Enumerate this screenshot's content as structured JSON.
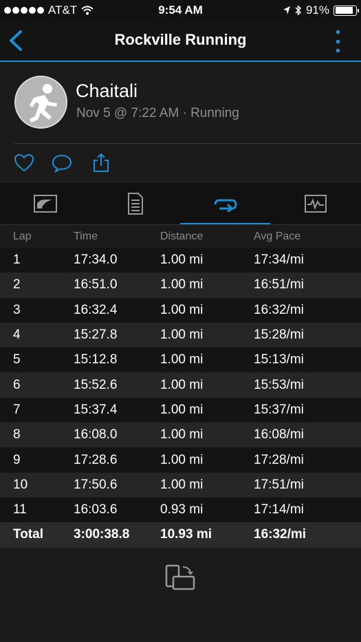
{
  "status_bar": {
    "carrier": "AT&T",
    "time": "9:54 AM",
    "battery": "91%",
    "battery_level": 0.91
  },
  "header": {
    "title": "Rockville Running"
  },
  "profile": {
    "name": "Chaitali",
    "meta": "Nov 5 @ 7:22 AM · Running"
  },
  "icons": {
    "back": "chevron-left-icon",
    "more": "more-vertical-icon",
    "like": "heart-icon",
    "comment": "comment-icon",
    "share": "share-icon",
    "tab_overview": "overview-chart-icon",
    "tab_details": "document-icon",
    "tab_laps": "laps-loop-icon",
    "tab_charts": "activity-graph-icon",
    "rotate": "rotate-screen-icon"
  },
  "colors": {
    "accent": "#1a8fd6",
    "background": "#1b1b1b"
  },
  "laps": {
    "headers": [
      "Lap",
      "Time",
      "Distance",
      "Avg Pace"
    ],
    "rows": [
      [
        "1",
        "17:34.0",
        "1.00 mi",
        "17:34/mi"
      ],
      [
        "2",
        "16:51.0",
        "1.00 mi",
        "16:51/mi"
      ],
      [
        "3",
        "16:32.4",
        "1.00 mi",
        "16:32/mi"
      ],
      [
        "4",
        "15:27.8",
        "1.00 mi",
        "15:28/mi"
      ],
      [
        "5",
        "15:12.8",
        "1.00 mi",
        "15:13/mi"
      ],
      [
        "6",
        "15:52.6",
        "1.00 mi",
        "15:53/mi"
      ],
      [
        "7",
        "15:37.4",
        "1.00 mi",
        "15:37/mi"
      ],
      [
        "8",
        "16:08.0",
        "1.00 mi",
        "16:08/mi"
      ],
      [
        "9",
        "17:28.6",
        "1.00 mi",
        "17:28/mi"
      ],
      [
        "10",
        "17:50.6",
        "1.00 mi",
        "17:51/mi"
      ],
      [
        "11",
        "16:03.6",
        "0.93 mi",
        "17:14/mi"
      ]
    ],
    "total": [
      "Total",
      "3:00:38.8",
      "10.93 mi",
      "16:32/mi"
    ]
  }
}
